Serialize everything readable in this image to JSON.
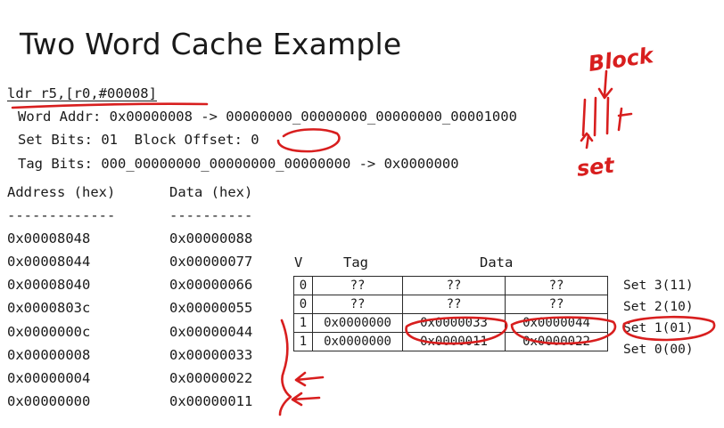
{
  "title": "Two Word Cache Example",
  "instruction": "ldr r5,[r0,#00008]",
  "word_addr_line": "Word Addr: 0x00000008 -> 00000000_00000000_00000000_00001000",
  "set_bits_line": "Set Bits: 01  Block Offset: 0",
  "tag_bits_line": "Tag Bits: 000_00000000_00000000_00000000 -> 0x0000000",
  "memory": {
    "address_header": "Address (hex)",
    "data_header": "Data (hex)",
    "address_sep": "-------------",
    "data_sep": "----------",
    "rows": [
      {
        "address": "0x00008048",
        "data": "0x00000088"
      },
      {
        "address": "0x00008044",
        "data": "0x00000077"
      },
      {
        "address": "0x00008040",
        "data": "0x00000066"
      },
      {
        "address": "0x0000803c",
        "data": "0x00000055"
      },
      {
        "address": "0x0000000c",
        "data": "0x00000044"
      },
      {
        "address": "0x00000008",
        "data": "0x00000033"
      },
      {
        "address": "0x00000004",
        "data": "0x00000022"
      },
      {
        "address": "0x00000000",
        "data": "0x00000011"
      }
    ]
  },
  "cache": {
    "headers": {
      "v": "V",
      "tag": "Tag",
      "data": "Data"
    },
    "rows": [
      {
        "v": "0",
        "tag": "??",
        "d0": "??",
        "d1": "??",
        "set": "Set 3(11)"
      },
      {
        "v": "0",
        "tag": "??",
        "d0": "??",
        "d1": "??",
        "set": "Set 2(10)"
      },
      {
        "v": "1",
        "tag": "0x0000000",
        "d0": "0x0000033",
        "d1": "0x0000044",
        "set": "Set 1(01)"
      },
      {
        "v": "1",
        "tag": "0x0000000",
        "d0": "0x0000011",
        "d1": "0x0000022",
        "set": "Set 0(00)"
      }
    ]
  },
  "annotations": {
    "block_label": "Block",
    "set_label": "set"
  },
  "colors": {
    "ink": "#d81e1e",
    "text": "#1a1a1a"
  }
}
